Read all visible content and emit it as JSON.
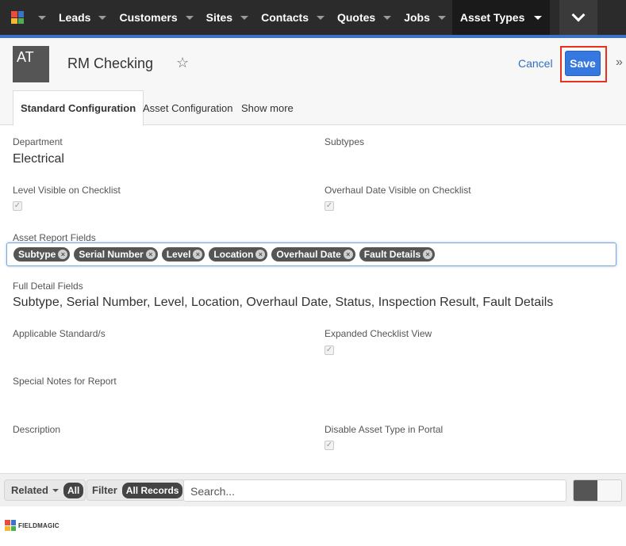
{
  "nav": {
    "items": [
      {
        "label": "Leads"
      },
      {
        "label": "Customers"
      },
      {
        "label": "Sites"
      },
      {
        "label": "Contacts"
      },
      {
        "label": "Quotes"
      },
      {
        "label": "Jobs"
      }
    ],
    "active_label": "Asset Types",
    "more_icon": "chevron-down-icon"
  },
  "header": {
    "avatar_initials": "AT",
    "title": "RM Checking",
    "star_icon": "star-icon",
    "cancel_label": "Cancel",
    "save_label": "Save",
    "expand_icon": "»"
  },
  "tabs": {
    "standard": "Standard Configuration",
    "asset": "Asset Configuration",
    "more": "Show more"
  },
  "fields": {
    "department_label": "Department",
    "department_value": "Electrical",
    "subtypes_label": "Subtypes",
    "level_visible_label": "Level Visible on Checklist",
    "overhaul_visible_label": "Overhaul Date Visible on Checklist",
    "asset_report_label": "Asset Report Fields",
    "asset_report_tags": [
      "Subtype",
      "Serial Number",
      "Level",
      "Location",
      "Overhaul Date",
      "Fault Details"
    ],
    "full_detail_label": "Full Detail Fields",
    "full_detail_value": "Subtype, Serial Number, Level, Location, Overhaul Date, Status, Inspection Result, Fault Details",
    "applicable_label": "Applicable Standard/s",
    "expanded_label": "Expanded Checklist View",
    "special_notes_label": "Special Notes for Report",
    "description_label": "Description",
    "disable_portal_label": "Disable Asset Type in Portal"
  },
  "footer": {
    "related_label": "Related",
    "related_pill": "All",
    "filter_label": "Filter",
    "filter_pill": "All Records",
    "search_placeholder": "Search..."
  },
  "brand": {
    "name": "FIELDMAGIC"
  },
  "colors": {
    "nav_bg": "#2b2b2b",
    "accent_blue": "#3d72c5",
    "save_bg": "#3478e0",
    "highlight_red": "#e8321c",
    "tag_bg": "#555555"
  }
}
